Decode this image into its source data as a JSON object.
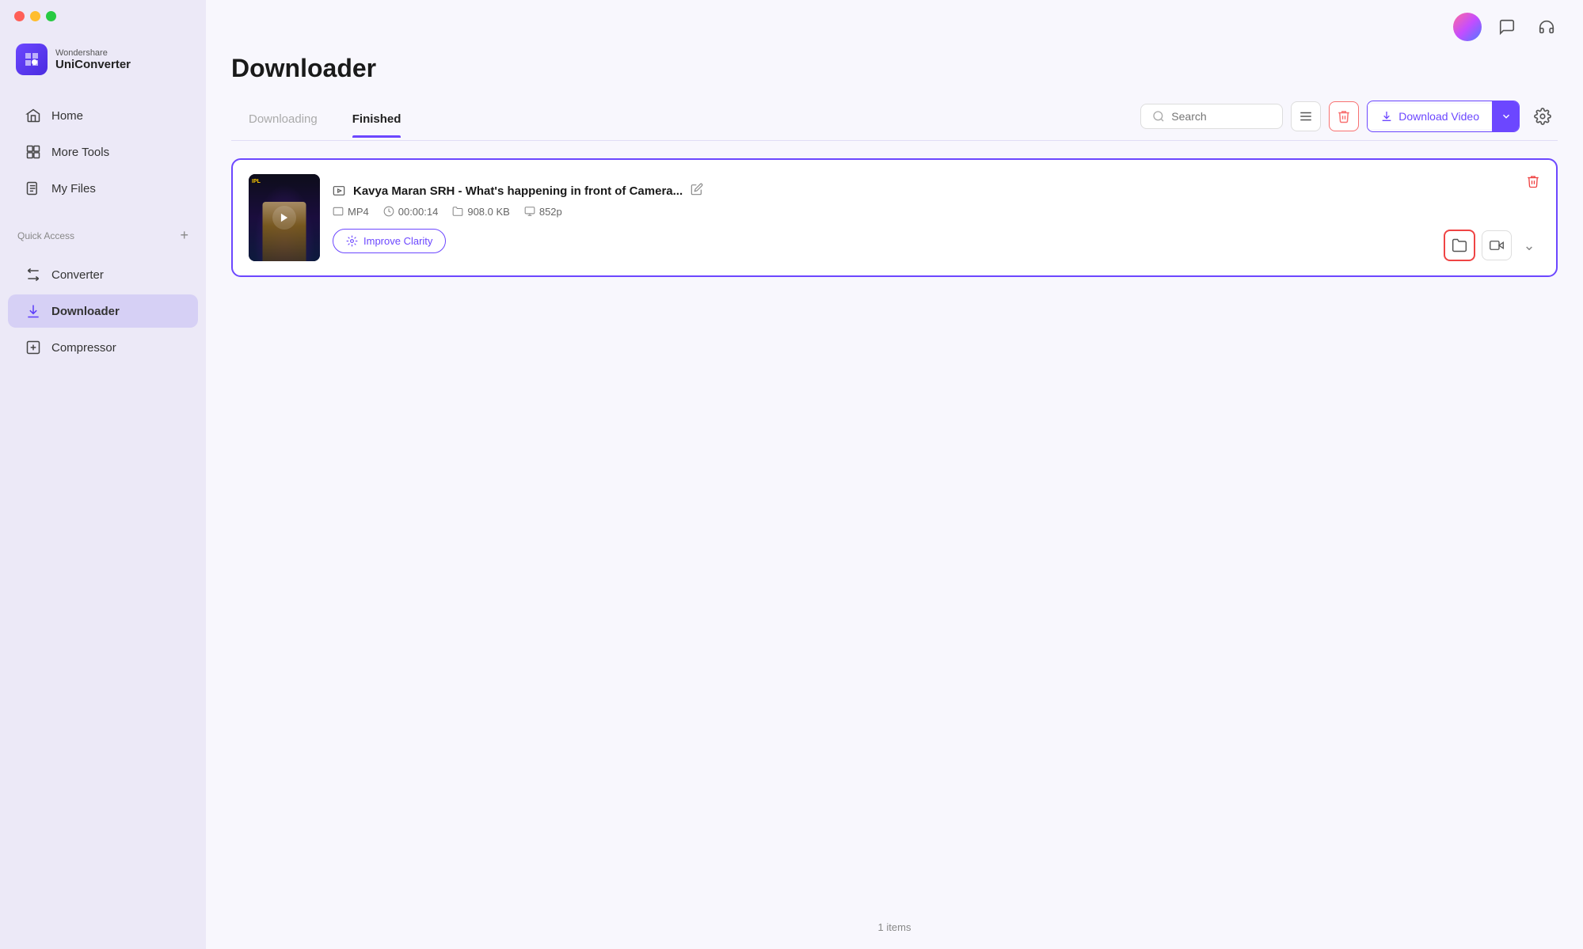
{
  "app": {
    "brand_top": "Wondershare",
    "brand_bottom": "UniConverter"
  },
  "traffic_lights": {
    "close": "close",
    "minimize": "minimize",
    "maximize": "maximize"
  },
  "sidebar": {
    "nav_items": [
      {
        "id": "home",
        "label": "Home",
        "icon": "home-icon",
        "active": false
      },
      {
        "id": "more-tools",
        "label": "More Tools",
        "icon": "grid-icon",
        "active": false
      },
      {
        "id": "my-files",
        "label": "My Files",
        "icon": "files-icon",
        "active": false
      }
    ],
    "quick_access_label": "Quick Access",
    "quick_access_items": [
      {
        "id": "converter",
        "label": "Converter",
        "icon": "converter-icon",
        "active": false
      },
      {
        "id": "downloader",
        "label": "Downloader",
        "icon": "downloader-icon",
        "active": true
      },
      {
        "id": "compressor",
        "label": "Compressor",
        "icon": "compressor-icon",
        "active": false
      }
    ]
  },
  "header": {
    "page_title": "Downloader"
  },
  "tabs": {
    "items": [
      {
        "id": "downloading",
        "label": "Downloading",
        "active": false
      },
      {
        "id": "finished",
        "label": "Finished",
        "active": true
      }
    ]
  },
  "toolbar": {
    "search_placeholder": "Search",
    "list_view_label": "List View",
    "delete_label": "Delete",
    "download_video_label": "Download Video",
    "settings_label": "Settings"
  },
  "video_card": {
    "title": "Kavya Maran SRH - What's happening in front of Camera...",
    "format": "MP4",
    "duration": "00:00:14",
    "size": "908.0 KB",
    "resolution": "852p",
    "thumbnail_text": "IPL",
    "improve_clarity_label": "Improve Clarity"
  },
  "footer": {
    "items_count": "1 items"
  }
}
